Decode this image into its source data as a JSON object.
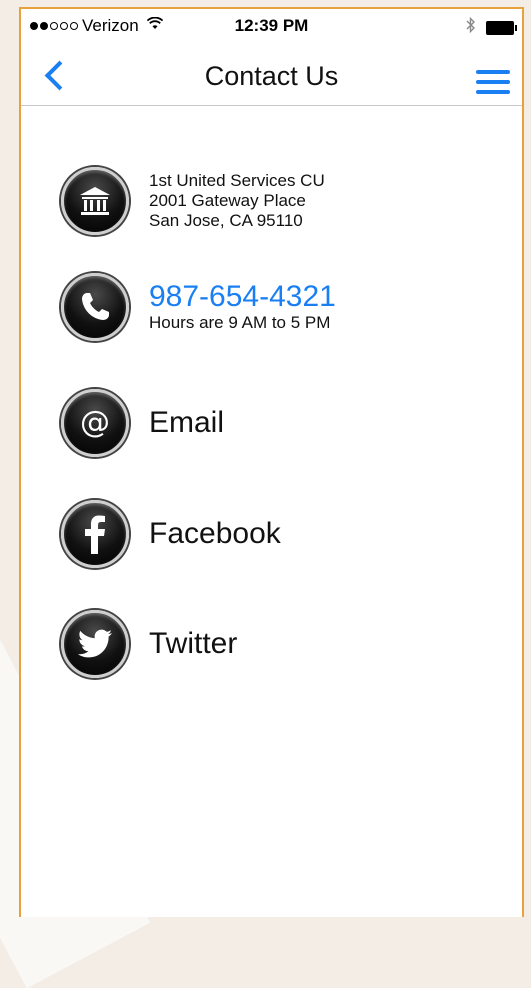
{
  "status_bar": {
    "carrier": "Verizon",
    "time": "12:39 PM"
  },
  "nav": {
    "title": "Contact Us"
  },
  "contacts": {
    "address": {
      "line1": "1st United Services CU",
      "line2": "2001 Gateway Place",
      "line3": "San Jose, CA 95110"
    },
    "phone": {
      "number": "987-654-4321",
      "hours": "Hours are 9 AM to 5 PM"
    },
    "email": {
      "label": "Email"
    },
    "facebook": {
      "label": "Facebook"
    },
    "twitter": {
      "label": "Twitter"
    }
  },
  "colors": {
    "accent": "#1a7ff2",
    "frame": "#e8a23c",
    "icon_bg": "#000000"
  },
  "icons": [
    "bank-icon",
    "phone-icon",
    "at-icon",
    "facebook-icon",
    "twitter-icon",
    "back-chevron-icon",
    "hamburger-menu-icon"
  ]
}
